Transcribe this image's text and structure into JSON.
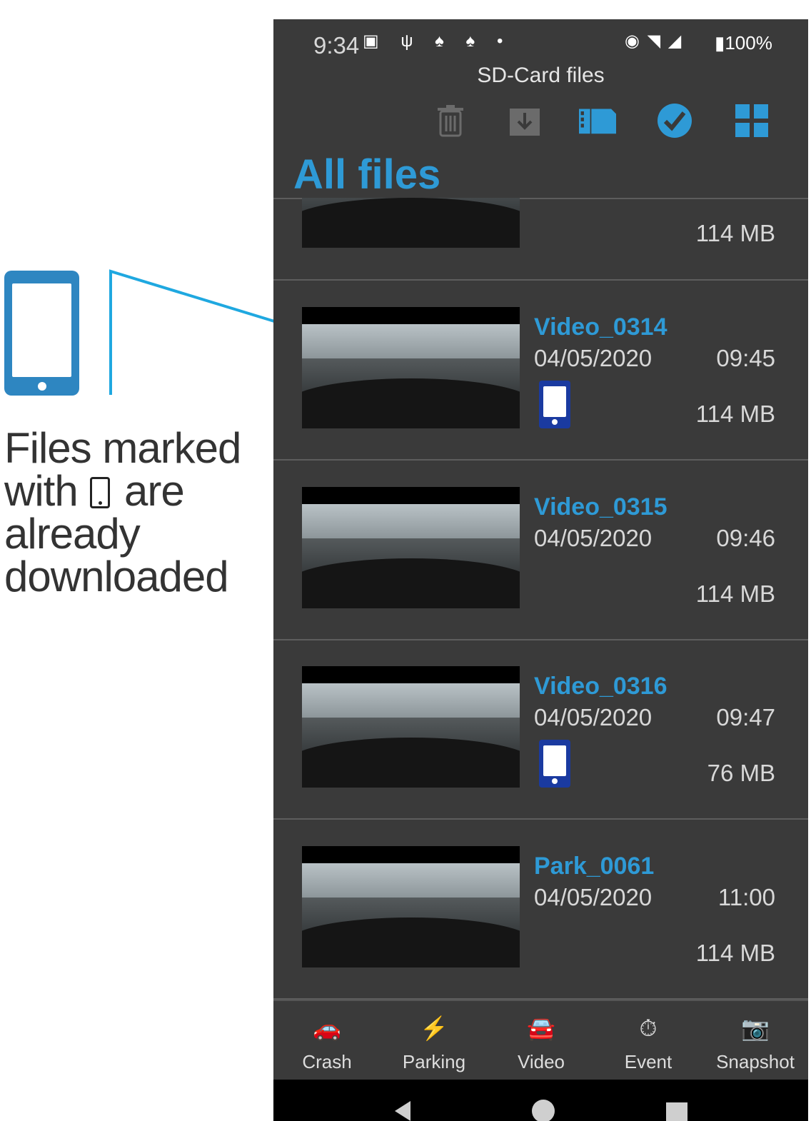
{
  "annotation": {
    "line1": "Files marked",
    "line2_before": "with",
    "line2_after": "are",
    "line3": "already",
    "line4": "downloaded",
    "accent": "#2e86c1"
  },
  "status_bar": {
    "time": "9:34",
    "left_icons": "▣ ψ ♠ ♠ •",
    "right_icons": "◉ ◥ ◢",
    "battery": "100%"
  },
  "app": {
    "title": "SD-Card files",
    "section_title": "All files",
    "accent": "#2e9ad6"
  },
  "toolbar": {
    "icons": [
      "trash-icon",
      "download-icon",
      "sd-card-icon",
      "select-check-icon",
      "grid-view-icon"
    ]
  },
  "files": [
    {
      "name": "",
      "date": "",
      "time": "",
      "size": "114  MB",
      "downloaded": false
    },
    {
      "name": "Video_0314",
      "date": "04/05/2020",
      "time": "09:45",
      "size": "114  MB",
      "downloaded": true
    },
    {
      "name": "Video_0315",
      "date": "04/05/2020",
      "time": "09:46",
      "size": "114  MB",
      "downloaded": false
    },
    {
      "name": "Video_0316",
      "date": "04/05/2020",
      "time": "09:47",
      "size": "76  MB",
      "downloaded": true
    },
    {
      "name": "Park_0061",
      "date": "04/05/2020",
      "time": "11:00",
      "size": "114  MB",
      "downloaded": false
    }
  ],
  "bottom_nav": [
    {
      "label": "Crash",
      "icon": "crash-icon",
      "glyph": "🚗"
    },
    {
      "label": "Parking",
      "icon": "lightning-icon",
      "glyph": "⚡"
    },
    {
      "label": "Video",
      "icon": "car-icon",
      "glyph": "🚘"
    },
    {
      "label": "Event",
      "icon": "event-icon",
      "glyph": "⏱"
    },
    {
      "label": "Snapshot",
      "icon": "camera-icon",
      "glyph": "📷"
    }
  ]
}
